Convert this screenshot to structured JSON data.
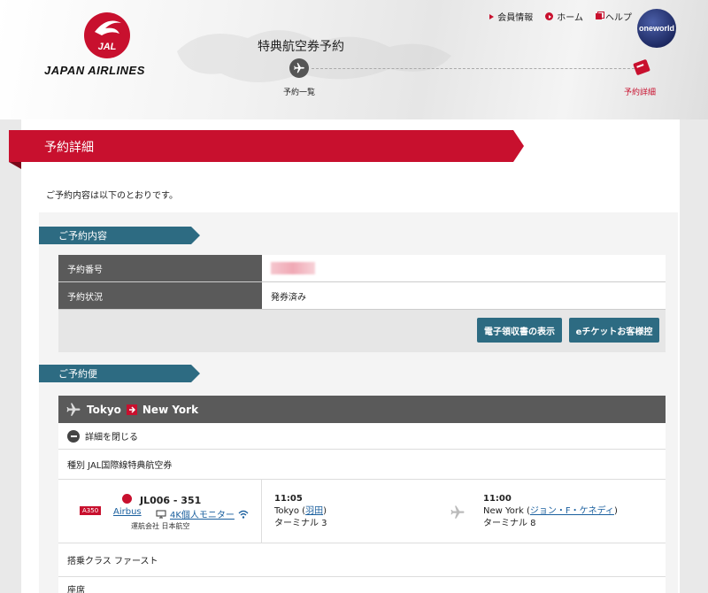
{
  "brand": {
    "logo_text": "JAPAN AIRLINES",
    "logo_mark": "JAL",
    "alliance": "oneworld",
    "accent": "#c8102e",
    "teal": "#2d6b82"
  },
  "top_nav": {
    "member_info": "会員情報",
    "home": "ホーム",
    "help": "ヘルプ"
  },
  "progress": {
    "title": "特典航空券予約",
    "step1": "予約一覧",
    "step2": "予約詳細"
  },
  "page": {
    "title": "予約詳細",
    "intro": "ご予約内容は以下のとおりです。"
  },
  "reservation": {
    "section_title": "ご予約内容",
    "number_label": "予約番号",
    "status_label": "予約状況",
    "status_value": "発券済み",
    "receipt_button": "電子領収書の表示",
    "eticket_button": "eチケットお客様控"
  },
  "flights": {
    "section_title": "ご予約便",
    "route_from": "Tokyo",
    "route_to": "New York",
    "toggle_label": "詳細を閉じる",
    "fare_type": "種別 JAL国際線特典航空券",
    "segment": {
      "aircraft_badge": "A350",
      "flight_number": "JL006 - 351",
      "aircraft_maker": "Airbus",
      "monitor": "4K個人モニター",
      "operator": "運航会社 日本航空",
      "dep_time": "11:05",
      "dep_city": "Tokyo (",
      "dep_airport": "羽田",
      "dep_close": ")",
      "dep_terminal": "ターミナル 3",
      "arr_time": "11:00",
      "arr_city": "New York (",
      "arr_airport": "ジョン・F・ケネディ",
      "arr_close": ")",
      "arr_terminal": "ターミナル 8"
    },
    "cabin": "搭乗クラス ファースト",
    "seat": "座席"
  }
}
